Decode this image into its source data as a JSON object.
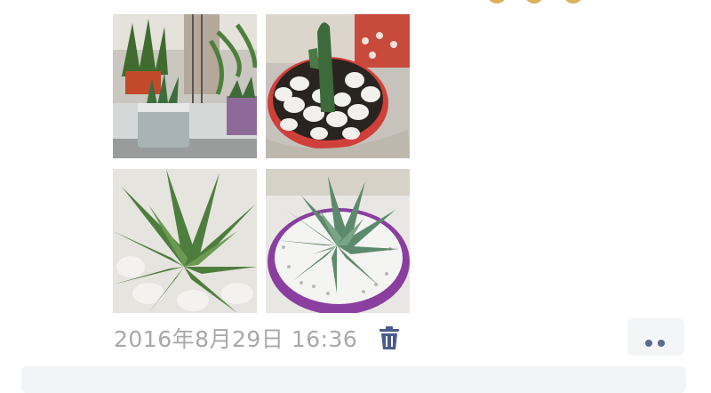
{
  "post": {
    "photos": [
      {
        "name": "potted-plants-photo"
      },
      {
        "name": "cactus-pot-photo"
      },
      {
        "name": "aloe-photo"
      },
      {
        "name": "succulent-purple-pot-photo"
      }
    ],
    "timestamp": "2016年8月29日 16:36",
    "delete_icon": "trash-icon",
    "more_icon": "more-dots-icon"
  },
  "colors": {
    "timestamp": "#a8a8a8",
    "accent": "#4a5a8a",
    "more_bg": "#f4f5f7"
  }
}
